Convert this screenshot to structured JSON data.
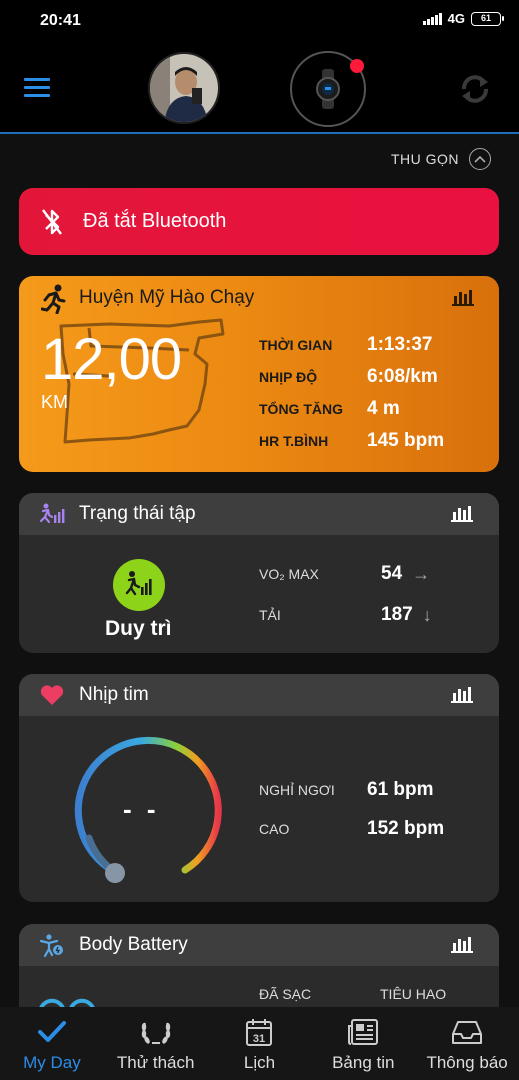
{
  "status_bar": {
    "time": "20:41",
    "network": "4G",
    "battery": "61"
  },
  "header": {
    "menu": "menu-icon",
    "avatar": "avatar",
    "device": "watch-icon",
    "sync": "sync-icon"
  },
  "collapse_label": "THU GỌN",
  "bluetooth_banner": {
    "text": "Đã tắt Bluetooth",
    "color": "#e3163a"
  },
  "run_card": {
    "title": "Huyện Mỹ Hào Chạy",
    "distance": "12,00",
    "unit": "KM",
    "stats": [
      {
        "label": "THỜI GIAN",
        "value": "1:13:37"
      },
      {
        "label": "NHỊP ĐỘ",
        "value": "6:08/km"
      },
      {
        "label": "TỔNG TĂNG",
        "value": "4 m"
      },
      {
        "label": "HR T.BÌNH",
        "value": "145 bpm"
      }
    ],
    "color": "#f59a1b"
  },
  "training_status": {
    "title": "Trạng thái tập",
    "status": "Duy trì",
    "vo2_label": "VO₂ MAX",
    "vo2_value": "54",
    "vo2_trend": "→",
    "load_label": "TẢI",
    "load_value": "187",
    "load_trend": "↓",
    "status_color": "#8cd31a"
  },
  "heart_rate": {
    "title": "Nhịp tim",
    "current": "- -",
    "resting_label": "NGHỈ NGƠI",
    "resting_value": "61 bpm",
    "high_label": "CAO",
    "high_value": "152 bpm"
  },
  "body_battery": {
    "title": "Body Battery",
    "charged_label": "ĐÃ SẠC",
    "drained_label": "TIÊU HAO"
  },
  "bottom_nav": [
    {
      "label": "My Day",
      "icon": "check-icon",
      "active": true
    },
    {
      "label": "Thử thách",
      "icon": "laurel-icon"
    },
    {
      "label": "Lịch",
      "icon": "calendar-icon",
      "day": "31"
    },
    {
      "label": "Bảng tin",
      "icon": "newsfeed-icon"
    },
    {
      "label": "Thông báo",
      "icon": "inbox-icon"
    }
  ],
  "accent": "#2c8de6"
}
